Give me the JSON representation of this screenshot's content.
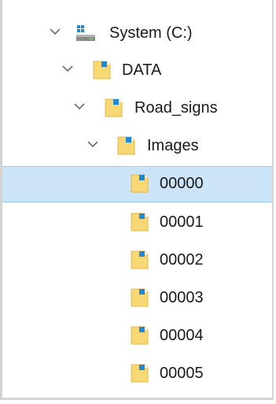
{
  "tree": {
    "nodes": [
      {
        "label": "System (C:)",
        "icon": "drive-icon",
        "expanded": true
      },
      {
        "label": "DATA",
        "icon": "folder-icon",
        "expanded": true
      },
      {
        "label": "Road_signs",
        "icon": "folder-icon",
        "expanded": true
      },
      {
        "label": "Images",
        "icon": "folder-icon",
        "expanded": true
      },
      {
        "label": "00000",
        "icon": "folder-icon",
        "selected": true
      },
      {
        "label": "00001",
        "icon": "folder-icon"
      },
      {
        "label": "00002",
        "icon": "folder-icon"
      },
      {
        "label": "00003",
        "icon": "folder-icon"
      },
      {
        "label": "00004",
        "icon": "folder-icon"
      },
      {
        "label": "00005",
        "icon": "folder-icon"
      }
    ]
  },
  "colors": {
    "selection_bg": "#cce4f7",
    "selection_border": "#99c9ef",
    "folder_yellow": "#f8d775",
    "folder_edge": "#e2b84a",
    "folder_accent": "#1e88d0"
  }
}
